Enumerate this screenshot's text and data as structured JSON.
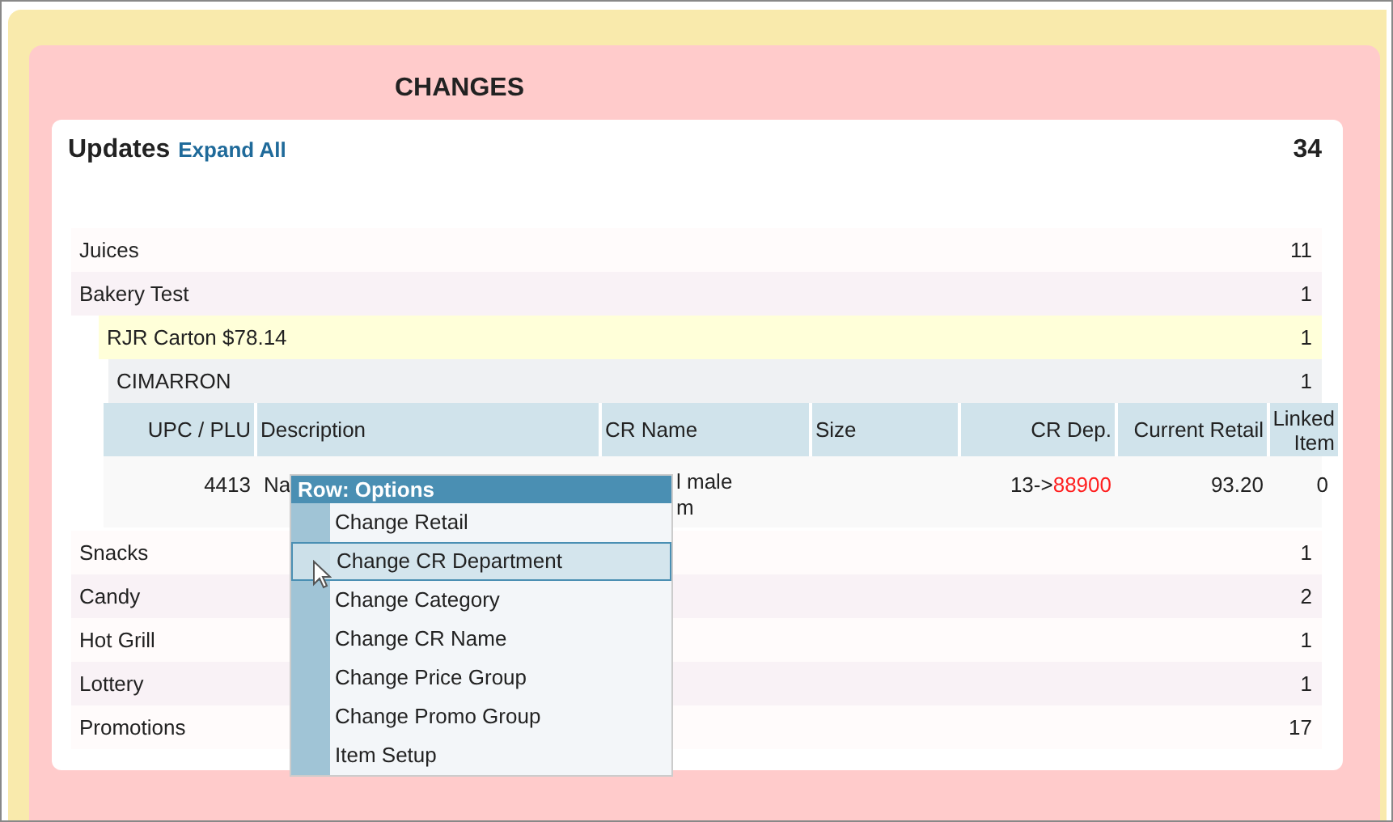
{
  "title": "CHANGES",
  "updates": {
    "title": "Updates",
    "expand_link": "Expand All",
    "total": "34"
  },
  "groups_before": [
    {
      "name": "Juices",
      "count": "11"
    },
    {
      "name": "Bakery Test",
      "count": "1"
    }
  ],
  "subgroup": {
    "name": "RJR Carton $78.14",
    "count": "1"
  },
  "subsubgroup": {
    "name": "CIMARRON",
    "count": "1"
  },
  "table": {
    "columns": [
      "UPC / PLU",
      "Description",
      "CR Name",
      "Size",
      "CR Dep.",
      "Current Retail",
      "Linked Item"
    ],
    "rows": [
      {
        "upc": "4413",
        "description": "Na",
        "cr_name": [
          "l male",
          "m"
        ],
        "cr_dep_old": "13->",
        "cr_dep_new": "88900",
        "current_retail": "93.20",
        "linked_item": "0"
      }
    ]
  },
  "groups_after": [
    {
      "name": "Snacks",
      "count": "1"
    },
    {
      "name": "Candy",
      "count": "2"
    },
    {
      "name": "Hot Grill",
      "count": "1"
    },
    {
      "name": "Lottery",
      "count": "1"
    },
    {
      "name": "Promotions",
      "count": "17"
    }
  ],
  "context_menu": {
    "title": "Row: Options",
    "items": [
      {
        "label": "Change Retail",
        "selected": false
      },
      {
        "label": "Change CR Department",
        "selected": true
      },
      {
        "label": "Change Category",
        "selected": false
      },
      {
        "label": "Change CR Name",
        "selected": false
      },
      {
        "label": "Change Price Group",
        "selected": false
      },
      {
        "label": "Change Promo Group",
        "selected": false
      },
      {
        "label": "Item Setup",
        "selected": false
      }
    ]
  }
}
